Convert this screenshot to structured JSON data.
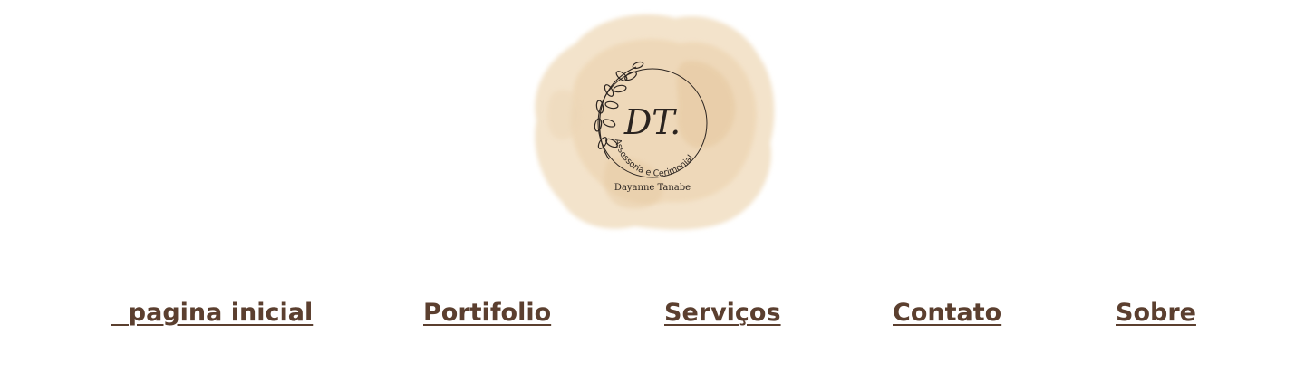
{
  "logo": {
    "monogram": "DT.",
    "tagline": "Assessoria e Cerimonial",
    "name": "Dayanne Tanabe",
    "colors": {
      "watercolor_light": "#f3e3cb",
      "watercolor_mid": "#eed7b6",
      "watercolor_dark": "#e6c9a1",
      "ink": "#2b2420"
    }
  },
  "nav": {
    "items": [
      {
        "label": "  pagina inicial"
      },
      {
        "label": "Portifolio"
      },
      {
        "label": "Serviços"
      },
      {
        "label": "Contato"
      },
      {
        "label": "Sobre"
      }
    ],
    "color": "#5b3f2f"
  }
}
